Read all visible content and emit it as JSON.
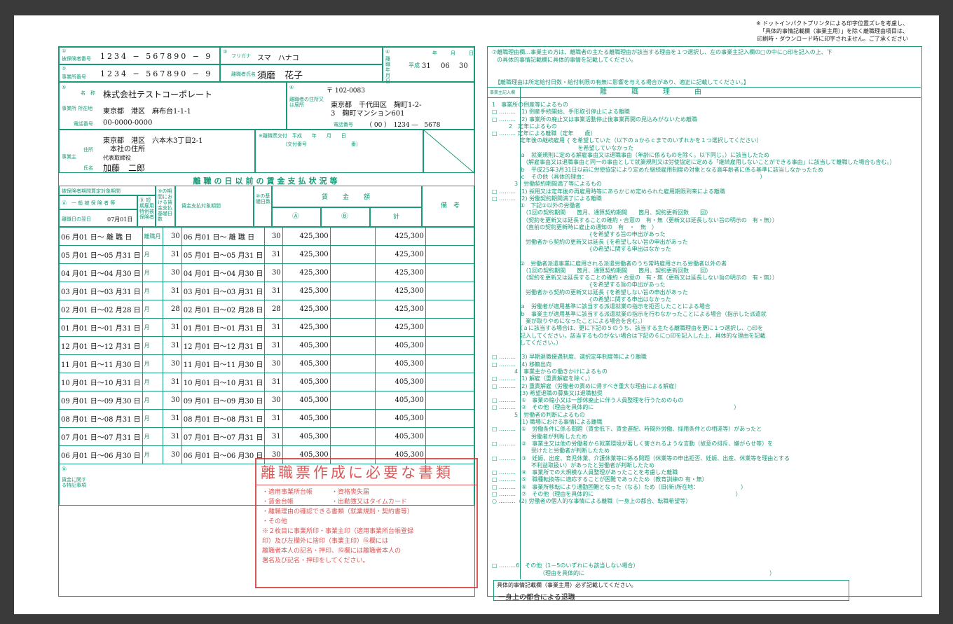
{
  "top_note": [
    "※ ドットインパクトプリンタによる印字位置ズレを考慮し、",
    "「具体的事情記載欄（事業主用）」を除く離職理由項目は、",
    "印刷時・ダウンロード時に印字されません。ご了承ください"
  ],
  "left": {
    "insured_no_label": "被保険者番号",
    "insured_no": "1234 − 567890 − 9",
    "office_no_label": "事業所番号",
    "office_no": "1234 − 567890 − 9",
    "furigana_label": "フリガナ",
    "furigana": "スマ　ハナコ",
    "name_label": "離職者氏名",
    "name": "須磨　花子",
    "date_label": "離職年月日",
    "era": "平成",
    "date_y": "31",
    "date_m": "06",
    "date_d": "30",
    "date_units": [
      "年",
      "月",
      "日"
    ],
    "office_name_label": "名　称",
    "office_name": "株式会社テストコーポレート",
    "office_addr_label": "事業所 所在地",
    "office_addr": "東京都　港区　麻布台1-1-1",
    "office_tel_label": "電話番号",
    "office_tel": "00-0000-0000",
    "postal": "〒 102-0083",
    "person_addr_label": "離職者の住所又は居所",
    "person_addr_1": "東京都　千代田区　麹町1-2-",
    "person_addr_2": "3　麹町マンション601",
    "person_tel_label": "電話番号",
    "person_tel": "（ 00 ）　1234 ―　5678",
    "employer_addr_label": "住所",
    "employer_addr_1": "東京都　港区　六本木3丁目2-1",
    "employer_addr_2": "本社の住所",
    "employer_label": "事業主",
    "employer_title": "代表取締役",
    "employer_name_label": "氏名",
    "employer_name": "加藤　二郎",
    "slip_note": "※離職票交付　平成　　年　　月　　日",
    "slip_note2": "（交付番号　　　　　　　　　番）",
    "wage_title": "離職の日以前の賃金支払状況等",
    "col_period": "被保険者期間算定対象期間",
    "col_general": "Ⓐ　一 般 被 保 険 者 等",
    "col_special": "Ⓑ 短期雇用特例被保険者",
    "col_days": "⑨の期間における賃金支払基礎日数",
    "col_pay_period": "賃金支払対象期間",
    "col_basis": "⑩の基礎日数",
    "col_amount": "賃　金　額",
    "col_a": "Ⓐ",
    "col_b": "Ⓑ",
    "col_total": "計",
    "col_remark": "備　考",
    "first_day_label": "離職日の翌日",
    "first_day": "07月01日",
    "rows": [
      {
        "p1": "06 月01 日～ 離 職 日",
        "u": "離職月",
        "d": "30",
        "p2": "06 月01 日～ 離 職 日",
        "b": "30",
        "a": "425,300",
        "t": "425,300"
      },
      {
        "p1": "05 月01 日～05 月31 日",
        "u": "月",
        "d": "31",
        "p2": "05 月01 日～05 月31 日",
        "b": "31",
        "a": "425,300",
        "t": "425,300"
      },
      {
        "p1": "04 月01 日～04 月30 日",
        "u": "月",
        "d": "30",
        "p2": "04 月01 日～04 月30 日",
        "b": "30",
        "a": "425,300",
        "t": "425,300"
      },
      {
        "p1": "03 月01 日～03 月31 日",
        "u": "月",
        "d": "31",
        "p2": "03 月01 日～03 月31 日",
        "b": "31",
        "a": "425,300",
        "t": "425,300"
      },
      {
        "p1": "02 月01 日～02 月28 日",
        "u": "月",
        "d": "28",
        "p2": "02 月01 日～02 月28 日",
        "b": "28",
        "a": "425,300",
        "t": "425,300"
      },
      {
        "p1": "01 月01 日～01 月31 日",
        "u": "月",
        "d": "31",
        "p2": "01 月01 日～01 月31 日",
        "b": "31",
        "a": "425,300",
        "t": "425,300"
      },
      {
        "p1": "12 月01 日～12 月31 日",
        "u": "月",
        "d": "31",
        "p2": "12 月01 日～12 月31 日",
        "b": "31",
        "a": "405,300",
        "t": "405,300"
      },
      {
        "p1": "11 月01 日～11 月30 日",
        "u": "月",
        "d": "30",
        "p2": "11 月01 日～11 月30 日",
        "b": "30",
        "a": "405,300",
        "t": "405,300"
      },
      {
        "p1": "10 月01 日～10 月31 日",
        "u": "月",
        "d": "31",
        "p2": "10 月01 日～10 月31 日",
        "b": "31",
        "a": "405,300",
        "t": "405,300"
      },
      {
        "p1": "09 月01 日～09 月30 日",
        "u": "月",
        "d": "30",
        "p2": "09 月01 日～09 月30 日",
        "b": "30",
        "a": "405,300",
        "t": "405,300"
      },
      {
        "p1": "08 月01 日～08 月31 日",
        "u": "月",
        "d": "31",
        "p2": "08 月01 日～08 月31 日",
        "b": "31",
        "a": "405,300",
        "t": "405,300"
      },
      {
        "p1": "07 月01 日～07 月31 日",
        "u": "月",
        "d": "31",
        "p2": "07 月01 日～07 月31 日",
        "b": "31",
        "a": "405,300",
        "t": "405,300"
      },
      {
        "p1": "06 月01 日～06 月30 日",
        "u": "月",
        "d": "30",
        "p2": "06 月01 日～06 月30 日",
        "b": "30",
        "a": "405,300",
        "t": "405,300"
      }
    ],
    "special_label": "賃金に関する特記事項"
  },
  "stamp": {
    "title": "離職票作成に必要な書類",
    "lines": [
      "・適用事業所台帳　　　・資格喪失届",
      "・賃金台帳　　　　　　・出勤簿又はタイムカード",
      "・離職理由の確認できる書類（就業規則・契約書等）",
      "・その他",
      "※２枚目に事業所印・事業主印（適用事業所台帳登録",
      "印）及び左欄外に捨印（事業主印）⑮欄には",
      "離職者本人の記名・押印、⑯欄には離職者本人の",
      "署名及び記名・押印をしてください。"
    ]
  },
  "right": {
    "header_1": "⑦離職理由欄…事業主の方は、離職者の主たる離職理由が該当する理由を１つ選択し、左の事業主記入欄の□の中に○印を記入の上、下",
    "header_2": "の具体的事情記載欄に具体的事情を記載してください。",
    "note": "【離職理由は所定給付日数・給付制限の有無に影響を与える場合があり、適正に記載してください。】",
    "col_employer": "事業主記入欄",
    "col_reason": "離　　職　　理　　由",
    "reasons_text": "1　事業所の倒産等によるもの\n□ ………  (1) 倒産手続開始、手形取引停止による離職\n□ ………  (2) 事業所の廃止又は事業活動停止後事業再開の見込みがないため離職\n　　　2　定年によるもの\n□ ……… 定年による離職（定年　　歳）\n　　　　　定年後の継続雇用 { を希望していた（以下のａからｃまでのいずれかを１つ選択してください）\n　　　　　　　　　　　　　　　 を希望していなかった\n　　　　　ａ　就業規則に定める解雇事由又は退職事由（年齢に係るものを除く。以下同じ。）に該当したため\n　　　　　　（解雇事由又は退職事由と同一の事由として就業規則又は労使協定に定める「継続雇用しないことができる事由」に該当して離職した場合も含む。）\n　　　　　ｂ　平成25年3月31日以前に労使協定により定めた継続雇用制度の対象となる高年齢者に係る基準に該当しなかったため\n　　　　　ｃ　その他（具体的理由：　　　　　　　　　　　　　　　　　　　　　　　　　　　　　　　 ）\n　　　　3　労働契約期間満了等によるもの\n□ ………  (1) 採用又は定年後の再雇用時等にあらかじめ定められた雇用期限到来による離職\n□ ………  (2) 労働契約期間満了による離職\n　　　　　①　下記②以外の労働者\n　　　　　　（1回の契約期間　　箇月、通算契約期間　　箇月、契約更新回数　　回）\n　　　　　　（契約を更新又は延長することの確約・合意の　有・無（更新又は延長しない旨の明示の　有・無））\n　　　　　　（直前の契約更新時に雇止め通知の　有　・　無　）\n　　　　　　　　　　　　　　　　　 {を希望する旨の申出があった\n　　　　　　労働者から契約の更新又は延長 {を希望しない旨の申出があった\n　　　　　　　　　　　　　　　　　 {の希望に関する申出はなかった\n\n　　　　　②　労働者派遣事業に雇用される派遣労働者のうち常時雇用される労働者以外の者\n　　　　　　（1回の契約期間　　箇月、通算契約期間　　箇月、契約更新回数　　回）\n　　　　　　（契約を更新又は延長することの確約・合意の　有・無（更新又は延長しない旨の明示の　有・無））\n　　　　　　　　　　　　　　　　　 {を希望する旨の申出があった\n　　　　　　労働者から契約の更新又は延長 {を希望しない旨の申出があった\n　　　　　　　　　　　　　　　　　 {の希望に関する申出はなかった\n　　　　　ａ　労働者が適用基準に該当する派遣就業の指示を拒否したことによる場合\n　　　　　ｂ　事業主が適用基準に該当する派遣就業の指示を行わなかったことによる場合（指示した派遣就\n　　　　　　業が取りやめになったことによる場合を含む。）\n　　　　　（ａに該当する場合は、更に下記の５のうち、該当する主たる離職理由を更に１つ選択し、○印を\n　　　　　記入してください。該当するものがない場合は下記の６に○印を記入した上、具体的な理由を記載\n　　　　　してください。）\n\n□ ………  (3) 早期退職優遇制度、選択定年制度等により離職\n□ ………  (4) 移籍出向\n　　　　4　事業主からの働きかけによるもの\n□ ………  (1) 解雇（重責解雇を除く。）\n□ ………  (2) 重責解雇（労働者の責めに帰すべき重大な理由による解雇）\n　　　　　(3) 希望退職の募集又は退職勧奨\n□ ………　①　事業の縮小又は一部休廃止に伴う人員整理を行うためのもの\n□ ………　②　その他（理由を具体的に　　　　　　　　　　　　　　　　　　　　　　　　　）\n　　　　5　労働者の判断によるもの\n　　　　　(1) 職場における事情による離職\n□ ………　①　労働条件に係る問題（賃金低下、賃金遅配、時間外労働、採用条件との相違等）があったと\n　　　　　　　労働者が判断したため\n□ ………　②　事業主又は他の労働者から就業環境が著しく害されるような言動（故意の排斥、嫌がらせ等）を\n　　　　　　　受けたと労働者が判断したため\n□ ………　③　妊娠、出産、育児休業、介護休業等に係る問題（休業等の申出拒否、妊娠、出産、休業等を理由とする\n　　　　　　　不利益取扱い）があったと労働者が判断したため\n□ ………　④　事業所での大規模な人員整理があったことを考慮した離職\n□ ………　⑤　職種転換等に適応することが困難であったため（教育訓練の 有・無）\n□ ………　⑥　事業所移転により通勤困難となった（なる）ため（旧(新)所在地：　　　　　　　　）\n□ ………　⑦　その他（理由を具体的に　　　　　　　　　　　　　　　　　　　　　　　　　 ）\n○ ………  (2) 労働者の個人的な事情による離職（一身上の都合、転職希望等）",
    "reason6": "□ ………6　その他（1－5のいずれにも該当しない場合）",
    "reason6b": "（理由を具体的に　　　　　　　　　　　　　　　　　　　　　　　　　　　　　　　　　）",
    "detail_label": "具体的事情記載欄（事業主用）必ず記載してください。",
    "detail_value": "一身上の都合による退職"
  }
}
